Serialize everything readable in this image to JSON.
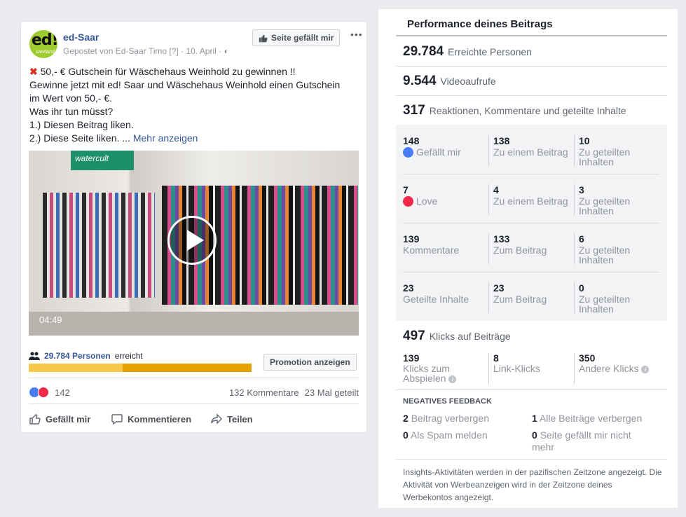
{
  "post": {
    "page_name": "ed-Saar",
    "avatar_text": "ed!",
    "avatar_sub": "saarland",
    "posted_by": "Gepostet von Ed-Saar Timo",
    "posted_by_badge": "[?]",
    "date": "10. April",
    "like_page_label": "Seite gefällt mir",
    "text_line1": "50,- € Gutschein für Wäschehaus Weinhold zu gewinnen !!",
    "text_line2": "Gewinne jetzt mit ed! Saar und Wäschehaus Weinhold einen Gutschein",
    "text_line3": "im Wert von 50,- €.",
    "text_line4": "Was ihr tun müsst?",
    "text_line5": "1.) Diesen Beitrag liken.",
    "text_line6": "2.) Diese Seite liken. ...",
    "more_link": "Mehr anzeigen",
    "video_sign": "watercult",
    "video_duration": "04:49",
    "reach_count": "29.784 Personen",
    "reach_suffix": "erreicht",
    "reach_fraction": 0.42,
    "promo_label": "Promotion anzeigen",
    "reaction_count": "142",
    "comments": "132 Kommentare",
    "shares": "23 Mal geteilt",
    "action_like": "Gefällt mir",
    "action_comment": "Kommentieren",
    "action_share": "Teilen"
  },
  "panel": {
    "title": "Performance deines Beitrags",
    "reach": {
      "value": "29.784",
      "label": "Erreichte Personen"
    },
    "views": {
      "value": "9.544",
      "label": "Videoaufrufe"
    },
    "engagement": {
      "value": "317",
      "label": "Reaktionen, Kommentare und geteilte Inhalte"
    },
    "grid": [
      [
        {
          "n": "148",
          "t": "Gefällt mir"
        },
        {
          "n": "138",
          "t": "Zu einem Beitrag"
        },
        {
          "n": "10",
          "t": "Zu geteilten Inhalten"
        }
      ],
      [
        {
          "n": "7",
          "t": "Love"
        },
        {
          "n": "4",
          "t": "Zu einem Beitrag"
        },
        {
          "n": "3",
          "t": "Zu geteilten Inhalten"
        }
      ],
      [
        {
          "n": "139",
          "t": "Kommentare"
        },
        {
          "n": "133",
          "t": "Zum Beitrag"
        },
        {
          "n": "6",
          "t": "Zu geteilten Inhalten"
        }
      ],
      [
        {
          "n": "23",
          "t": "Geteilte Inhalte"
        },
        {
          "n": "23",
          "t": "Zum Beitrag"
        },
        {
          "n": "0",
          "t": "Zu geteilten Inhalten"
        }
      ]
    ],
    "clicks": {
      "value": "497",
      "label": "Klicks auf Beiträge"
    },
    "click_items": [
      {
        "n": "139",
        "t": "Klicks zum Abspielen"
      },
      {
        "n": "8",
        "t": "Link-Klicks"
      },
      {
        "n": "350",
        "t": "Andere Klicks"
      }
    ],
    "negative_title": "NEGATIVES FEEDBACK",
    "negative": [
      {
        "n": "2",
        "t": "Beitrag verbergen"
      },
      {
        "n": "1",
        "t": "Alle Beiträge verbergen"
      },
      {
        "n": "0",
        "t": "Als Spam melden"
      },
      {
        "n": "0",
        "t": "Seite gefällt mir nicht mehr"
      }
    ],
    "footer": "Insights-Aktivitäten werden in der pazifischen Zeitzone angezeigt. Die Aktivität von Werbeanzeigen wird in der Zeitzone deines Werbekontos angezeigt."
  }
}
